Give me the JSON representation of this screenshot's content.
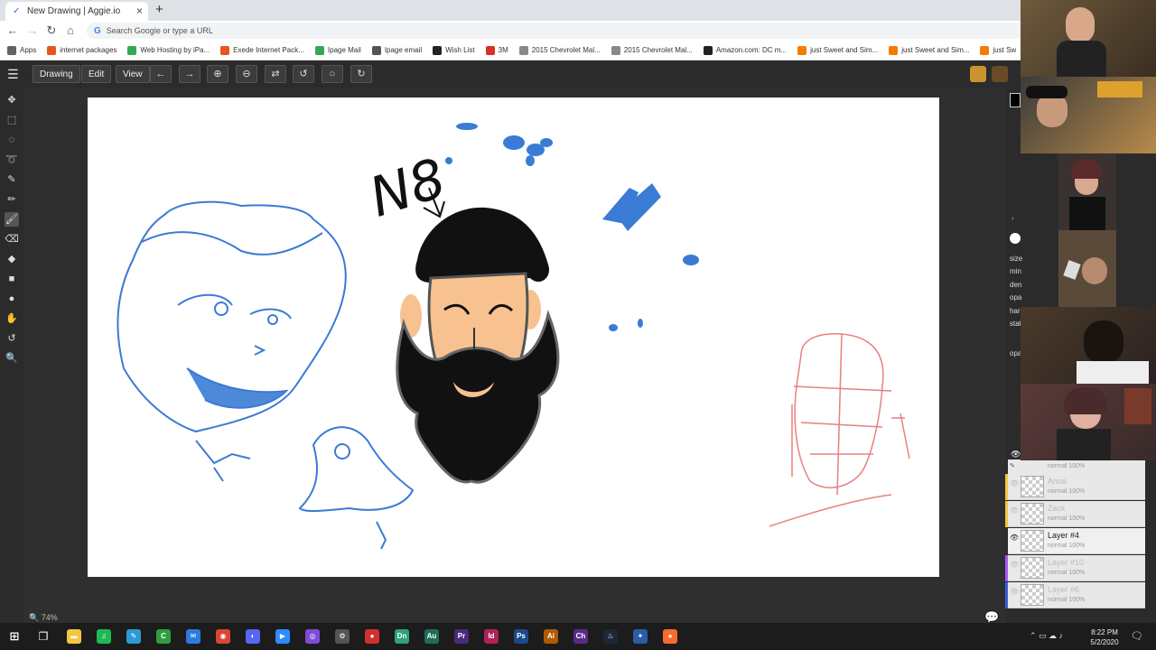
{
  "browser": {
    "tab_title": "New Drawing | Aggie.io",
    "omnibox_placeholder": "Search Google or type a URL",
    "new_tab": "+",
    "close_tab": "×"
  },
  "bookmarks": [
    {
      "label": "Apps",
      "color": "#5f6368"
    },
    {
      "label": "internet packages",
      "color": "#e8541f"
    },
    {
      "label": "Web Hosting by iPa...",
      "color": "#34a853"
    },
    {
      "label": "Exede Internet Pack...",
      "color": "#e8541f"
    },
    {
      "label": "Ipage Mail",
      "color": "#34a853"
    },
    {
      "label": "Ipage email",
      "color": "#555555"
    },
    {
      "label": "Wish List",
      "color": "#222222"
    },
    {
      "label": "3M",
      "color": "#d93025"
    },
    {
      "label": "2015 Chevrolet Mal...",
      "color": "#888888"
    },
    {
      "label": "2015 Chevrolet Mal...",
      "color": "#888888"
    },
    {
      "label": "Amazon.com: DC m...",
      "color": "#222222"
    },
    {
      "label": "just Sweet and Sim...",
      "color": "#f57c00"
    },
    {
      "label": "just Sweet and Sim...",
      "color": "#f57c00"
    },
    {
      "label": "just Sw",
      "color": "#f57c00"
    }
  ],
  "app": {
    "menus": [
      "Drawing",
      "Edit",
      "View"
    ],
    "zoom_level": "74%",
    "props": [
      "size",
      "min",
      "den",
      "opa",
      "har",
      "stat",
      "opa"
    ]
  },
  "layers": [
    {
      "name": "Anna",
      "mode": "normal 100%",
      "color": "#f4c542",
      "active": false
    },
    {
      "name": "Zack",
      "mode": "normal 100%",
      "color": "#f4c542",
      "active": false
    },
    {
      "name": "Layer #4",
      "mode": "normal 100%",
      "color": "#2b2b2b",
      "active": true
    },
    {
      "name": "Layer #10",
      "mode": "normal 100%",
      "color": "#a855f7",
      "active": false
    },
    {
      "name": "Layer #6",
      "mode": "normal 100%",
      "color": "#3b5bdb",
      "active": false
    }
  ],
  "top_layer_mode": "normal 100%",
  "canvas_text": "N8",
  "clock": {
    "time": "8:22 PM",
    "date": "5/2/2020"
  },
  "colors": {
    "blue_ink": "#3a7bd5",
    "red_ink": "#e88080",
    "skin": "#f7c28f"
  }
}
